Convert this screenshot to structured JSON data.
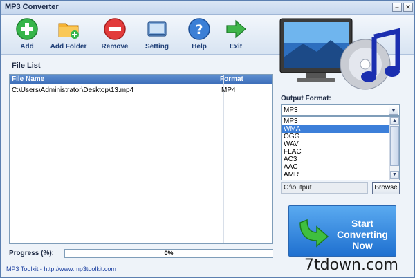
{
  "window": {
    "title": "MP3 Converter"
  },
  "toolbar": {
    "items": [
      {
        "label": "Add",
        "icon": "add-icon"
      },
      {
        "label": "Add Folder",
        "icon": "add-folder-icon"
      },
      {
        "label": "Remove",
        "icon": "remove-icon"
      },
      {
        "label": "Setting",
        "icon": "setting-icon"
      },
      {
        "label": "Help",
        "icon": "help-icon"
      },
      {
        "label": "Exit",
        "icon": "exit-icon"
      }
    ]
  },
  "file_list": {
    "label": "File List",
    "columns": [
      "File Name",
      "Format"
    ],
    "rows": [
      {
        "file_name": "C:\\Users\\Administrator\\Desktop\\13.mp4",
        "format": "MP4"
      }
    ]
  },
  "output": {
    "label": "Output Format:",
    "selected": "MP3",
    "options": [
      "MP3",
      "WMA",
      "OGG",
      "WAV",
      "FLAC",
      "AC3",
      "AAC",
      "AMR"
    ],
    "highlighted": "WMA",
    "path": "C:\\output",
    "browse_label": "Browse"
  },
  "progress": {
    "label": "Progress (%):",
    "value_text": "0%",
    "value": 0
  },
  "start_button": {
    "label_line1": "Start",
    "label_line2": "Converting",
    "label_line3": "Now"
  },
  "footer": {
    "link_text": "MP3 Toolkit - http://www.mp3toolkit.com"
  },
  "watermark": "7tdown.com",
  "colors": {
    "accent": "#3c7fd9",
    "toolbar_label": "#1f3f77",
    "start_button": "#1f70d0"
  }
}
